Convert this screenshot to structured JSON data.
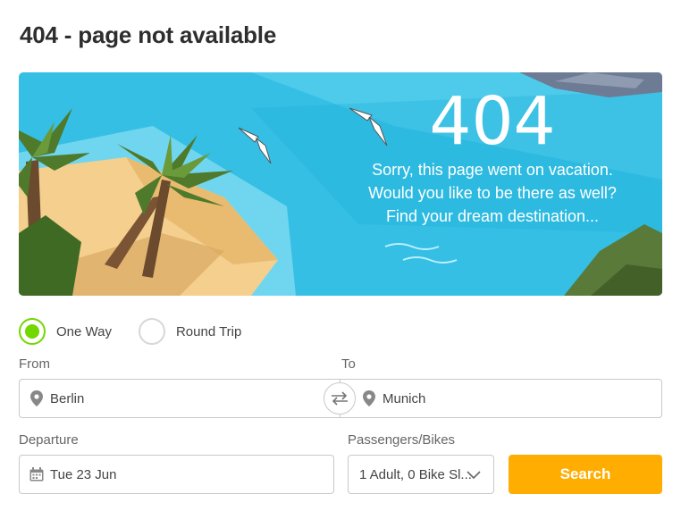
{
  "page": {
    "title": "404 - page not available"
  },
  "banner": {
    "code": "404",
    "lines": [
      "Sorry, this page went on vacation.",
      "Would you like to be there as well?",
      "Find your dream destination..."
    ]
  },
  "trip_type": {
    "options": [
      {
        "label": "One Way",
        "selected": true
      },
      {
        "label": "Round Trip",
        "selected": false
      }
    ]
  },
  "search": {
    "from_label": "From",
    "from_value": "Berlin",
    "to_label": "To",
    "to_value": "Munich",
    "departure_label": "Departure",
    "departure_value": "Tue 23 Jun",
    "passengers_label": "Passengers/Bikes",
    "passengers_value": "1 Adult, 0 Bike Sl...",
    "search_button": "Search"
  },
  "icons": {
    "from": "location-pin-icon",
    "to": "location-pin-icon",
    "swap": "swap-arrows-icon",
    "departure": "calendar-icon",
    "passengers": "chevron-down-icon"
  },
  "colors": {
    "accent_green": "#73d700",
    "search_orange": "#ffad00",
    "sea": "#3cc3e6",
    "sand": "#f4cf8e"
  }
}
